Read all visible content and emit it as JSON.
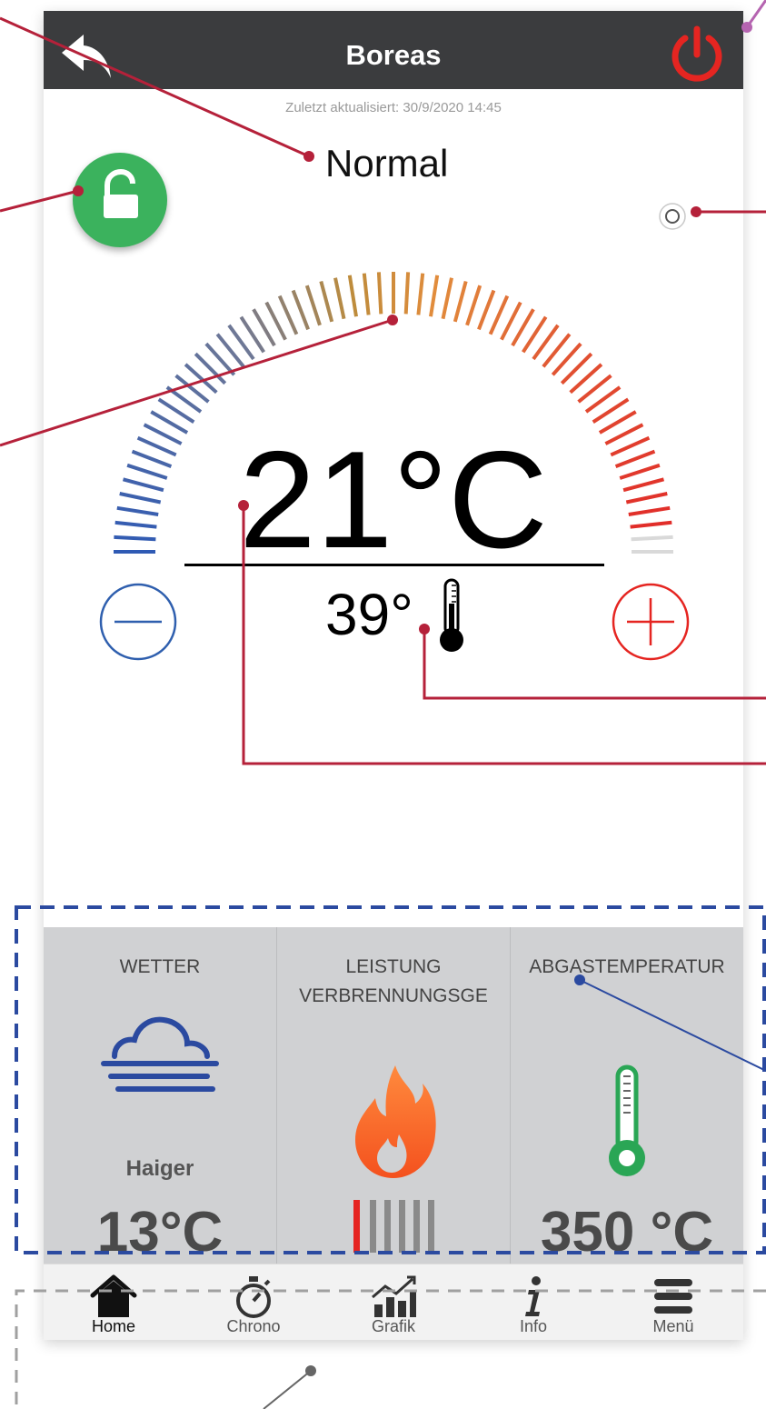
{
  "header": {
    "title": "Boreas"
  },
  "status": {
    "last_updated": "Zuletzt aktualisiert: 30/9/2020 14:45",
    "mode": "Normal"
  },
  "thermostat": {
    "setpoint": "21°C",
    "current": "39°"
  },
  "tiles": [
    {
      "title": "WETTER",
      "subtitle": "",
      "place": "Haiger",
      "value": "13°C",
      "icon": "fog-cloud-icon"
    },
    {
      "title": "LEISTUNG",
      "subtitle": "VERBRENNUNGSGE",
      "place": "",
      "value": "",
      "icon": "flame-icon",
      "power_level": "1 of 6"
    },
    {
      "title": "ABGASTEMPERATUR",
      "subtitle": "",
      "place": "",
      "value": "350 °C",
      "icon": "thermometer-icon"
    }
  ],
  "nav": [
    {
      "label": "Home",
      "icon": "home-icon"
    },
    {
      "label": "Chrono",
      "icon": "stopwatch-icon"
    },
    {
      "label": "Grafik",
      "icon": "chart-icon"
    },
    {
      "label": "Info",
      "icon": "info-icon"
    },
    {
      "label": "Menü",
      "icon": "menu-icon"
    }
  ],
  "colors": {
    "appbar": "#3b3c3e",
    "power": "#e52521",
    "lock": "#3bb25d",
    "minus": "#2f5fae",
    "plus": "#e52521",
    "tile_bg": "#d0d1d3",
    "flame": "#f4511e",
    "thermo": "#2aa655"
  }
}
